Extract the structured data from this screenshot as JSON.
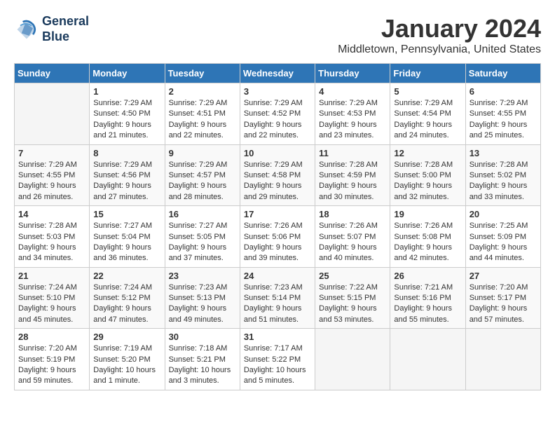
{
  "logo": {
    "line1": "General",
    "line2": "Blue"
  },
  "title": "January 2024",
  "location": "Middletown, Pennsylvania, United States",
  "weekdays": [
    "Sunday",
    "Monday",
    "Tuesday",
    "Wednesday",
    "Thursday",
    "Friday",
    "Saturday"
  ],
  "weeks": [
    [
      {
        "day": "",
        "empty": true
      },
      {
        "day": "1",
        "sunrise": "Sunrise: 7:29 AM",
        "sunset": "Sunset: 4:50 PM",
        "daylight": "Daylight: 9 hours and 21 minutes."
      },
      {
        "day": "2",
        "sunrise": "Sunrise: 7:29 AM",
        "sunset": "Sunset: 4:51 PM",
        "daylight": "Daylight: 9 hours and 22 minutes."
      },
      {
        "day": "3",
        "sunrise": "Sunrise: 7:29 AM",
        "sunset": "Sunset: 4:52 PM",
        "daylight": "Daylight: 9 hours and 22 minutes."
      },
      {
        "day": "4",
        "sunrise": "Sunrise: 7:29 AM",
        "sunset": "Sunset: 4:53 PM",
        "daylight": "Daylight: 9 hours and 23 minutes."
      },
      {
        "day": "5",
        "sunrise": "Sunrise: 7:29 AM",
        "sunset": "Sunset: 4:54 PM",
        "daylight": "Daylight: 9 hours and 24 minutes."
      },
      {
        "day": "6",
        "sunrise": "Sunrise: 7:29 AM",
        "sunset": "Sunset: 4:55 PM",
        "daylight": "Daylight: 9 hours and 25 minutes."
      }
    ],
    [
      {
        "day": "7",
        "sunrise": "Sunrise: 7:29 AM",
        "sunset": "Sunset: 4:55 PM",
        "daylight": "Daylight: 9 hours and 26 minutes."
      },
      {
        "day": "8",
        "sunrise": "Sunrise: 7:29 AM",
        "sunset": "Sunset: 4:56 PM",
        "daylight": "Daylight: 9 hours and 27 minutes."
      },
      {
        "day": "9",
        "sunrise": "Sunrise: 7:29 AM",
        "sunset": "Sunset: 4:57 PM",
        "daylight": "Daylight: 9 hours and 28 minutes."
      },
      {
        "day": "10",
        "sunrise": "Sunrise: 7:29 AM",
        "sunset": "Sunset: 4:58 PM",
        "daylight": "Daylight: 9 hours and 29 minutes."
      },
      {
        "day": "11",
        "sunrise": "Sunrise: 7:28 AM",
        "sunset": "Sunset: 4:59 PM",
        "daylight": "Daylight: 9 hours and 30 minutes."
      },
      {
        "day": "12",
        "sunrise": "Sunrise: 7:28 AM",
        "sunset": "Sunset: 5:00 PM",
        "daylight": "Daylight: 9 hours and 32 minutes."
      },
      {
        "day": "13",
        "sunrise": "Sunrise: 7:28 AM",
        "sunset": "Sunset: 5:02 PM",
        "daylight": "Daylight: 9 hours and 33 minutes."
      }
    ],
    [
      {
        "day": "14",
        "sunrise": "Sunrise: 7:28 AM",
        "sunset": "Sunset: 5:03 PM",
        "daylight": "Daylight: 9 hours and 34 minutes."
      },
      {
        "day": "15",
        "sunrise": "Sunrise: 7:27 AM",
        "sunset": "Sunset: 5:04 PM",
        "daylight": "Daylight: 9 hours and 36 minutes."
      },
      {
        "day": "16",
        "sunrise": "Sunrise: 7:27 AM",
        "sunset": "Sunset: 5:05 PM",
        "daylight": "Daylight: 9 hours and 37 minutes."
      },
      {
        "day": "17",
        "sunrise": "Sunrise: 7:26 AM",
        "sunset": "Sunset: 5:06 PM",
        "daylight": "Daylight: 9 hours and 39 minutes."
      },
      {
        "day": "18",
        "sunrise": "Sunrise: 7:26 AM",
        "sunset": "Sunset: 5:07 PM",
        "daylight": "Daylight: 9 hours and 40 minutes."
      },
      {
        "day": "19",
        "sunrise": "Sunrise: 7:26 AM",
        "sunset": "Sunset: 5:08 PM",
        "daylight": "Daylight: 9 hours and 42 minutes."
      },
      {
        "day": "20",
        "sunrise": "Sunrise: 7:25 AM",
        "sunset": "Sunset: 5:09 PM",
        "daylight": "Daylight: 9 hours and 44 minutes."
      }
    ],
    [
      {
        "day": "21",
        "sunrise": "Sunrise: 7:24 AM",
        "sunset": "Sunset: 5:10 PM",
        "daylight": "Daylight: 9 hours and 45 minutes."
      },
      {
        "day": "22",
        "sunrise": "Sunrise: 7:24 AM",
        "sunset": "Sunset: 5:12 PM",
        "daylight": "Daylight: 9 hours and 47 minutes."
      },
      {
        "day": "23",
        "sunrise": "Sunrise: 7:23 AM",
        "sunset": "Sunset: 5:13 PM",
        "daylight": "Daylight: 9 hours and 49 minutes."
      },
      {
        "day": "24",
        "sunrise": "Sunrise: 7:23 AM",
        "sunset": "Sunset: 5:14 PM",
        "daylight": "Daylight: 9 hours and 51 minutes."
      },
      {
        "day": "25",
        "sunrise": "Sunrise: 7:22 AM",
        "sunset": "Sunset: 5:15 PM",
        "daylight": "Daylight: 9 hours and 53 minutes."
      },
      {
        "day": "26",
        "sunrise": "Sunrise: 7:21 AM",
        "sunset": "Sunset: 5:16 PM",
        "daylight": "Daylight: 9 hours and 55 minutes."
      },
      {
        "day": "27",
        "sunrise": "Sunrise: 7:20 AM",
        "sunset": "Sunset: 5:17 PM",
        "daylight": "Daylight: 9 hours and 57 minutes."
      }
    ],
    [
      {
        "day": "28",
        "sunrise": "Sunrise: 7:20 AM",
        "sunset": "Sunset: 5:19 PM",
        "daylight": "Daylight: 9 hours and 59 minutes."
      },
      {
        "day": "29",
        "sunrise": "Sunrise: 7:19 AM",
        "sunset": "Sunset: 5:20 PM",
        "daylight": "Daylight: 10 hours and 1 minute."
      },
      {
        "day": "30",
        "sunrise": "Sunrise: 7:18 AM",
        "sunset": "Sunset: 5:21 PM",
        "daylight": "Daylight: 10 hours and 3 minutes."
      },
      {
        "day": "31",
        "sunrise": "Sunrise: 7:17 AM",
        "sunset": "Sunset: 5:22 PM",
        "daylight": "Daylight: 10 hours and 5 minutes."
      },
      {
        "day": "",
        "empty": true
      },
      {
        "day": "",
        "empty": true
      },
      {
        "day": "",
        "empty": true
      }
    ]
  ]
}
